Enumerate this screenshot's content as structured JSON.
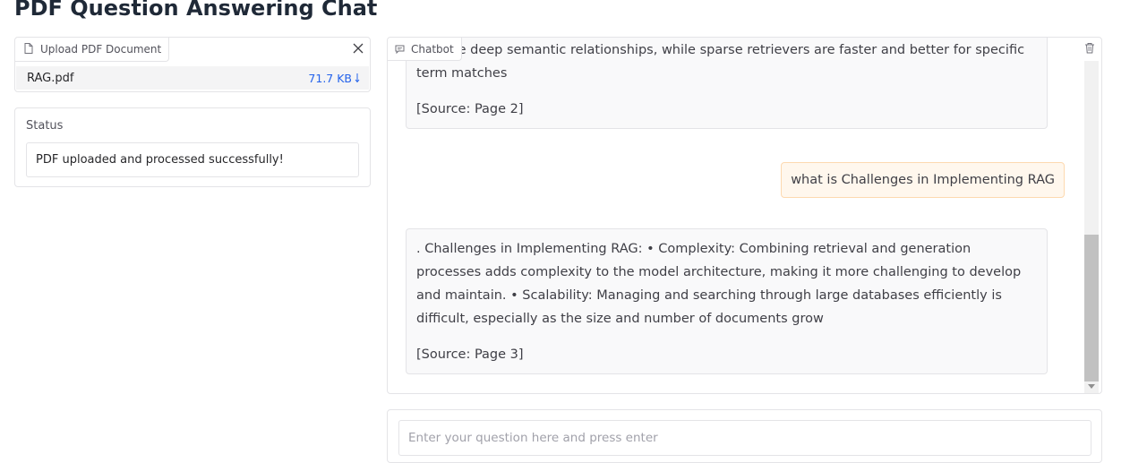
{
  "page": {
    "title": "PDF Question Answering Chat"
  },
  "upload": {
    "label": "Upload PDF Document",
    "file_name": "RAG.pdf",
    "file_size": "71.7 KB"
  },
  "status": {
    "label": "Status",
    "value": "PDF uploaded and processed successfully!"
  },
  "chat": {
    "label": "Chatbot",
    "messages": [
      {
        "role": "bot",
        "text": "capture deep semantic relationships, while sparse retrievers are faster and better for specific term matches",
        "source": "[Source: Page 2]"
      },
      {
        "role": "user",
        "text": "what is Challenges in Implementing RAG"
      },
      {
        "role": "bot",
        "text": ". Challenges in Implementing RAG: • Complexity: Combining retrieval and generation processes adds complexity to the model architecture, making it more challenging to develop and maintain. • Scalability: Managing and searching through large databases efficiently is difficult, especially as the size and number of documents grow",
        "source": "[Source: Page 3]"
      }
    ],
    "scroll_position_fraction": 0.6
  },
  "input": {
    "placeholder": "Enter your question here and press enter",
    "value": ""
  },
  "colors": {
    "accent": "#2563eb",
    "user_bubble_bg": "#fff7ed",
    "user_bubble_border": "#fdd9b0",
    "bot_bubble_bg": "#f9f9fa"
  },
  "icons": {
    "upload": "file-icon",
    "close": "close-icon",
    "download": "download-icon",
    "chatbot": "chat-icon",
    "clear": "trash-icon"
  }
}
